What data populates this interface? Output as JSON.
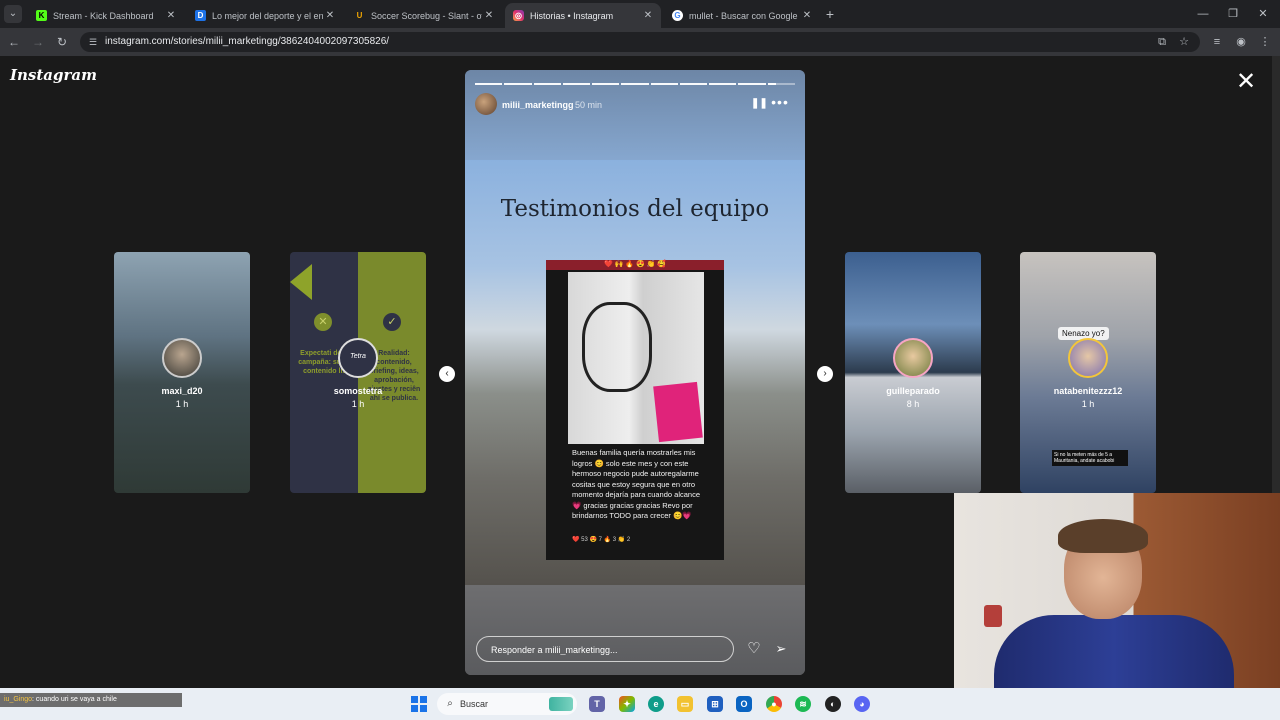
{
  "browser": {
    "tabs": [
      {
        "title": "Stream - Kick Dashboard",
        "favicon": "kick-icon",
        "active": false
      },
      {
        "title": "Lo mejor del deporte y el entre",
        "favicon": "olga-icon",
        "active": false
      },
      {
        "title": "Soccer Scorebug - Slant - over",
        "favicon": "uno-icon",
        "active": false
      },
      {
        "title": "Historias • Instagram",
        "favicon": "instagram-icon",
        "active": true
      },
      {
        "title": "mullet - Buscar con Google",
        "favicon": "google-icon",
        "active": false
      }
    ],
    "url": "instagram.com/stories/milii_marketingg/3862404002097305826/"
  },
  "instagram": {
    "logo": "Instagram",
    "story": {
      "username": "milii_marketingg",
      "time": "50 min",
      "progress_segments": 11,
      "current_segment": 11,
      "current_segment_progress": 0.3,
      "title": "Testimonios del equipo",
      "post_emojis": "❤️ 🙌 🔥 😍 👏 🥰",
      "post_text": "Buenas familia quería mostrarles mis logros 😊 solo este mes y con este hermoso negocio pude autoregalarme cositas que estoy segura que en otro momento dejaría para cuando alcance 💗 gracias gracias gracias Revo por brindarnos TODO para crecer 😊💗",
      "post_reactions": "❤️ 53   😍 7   🔥 3   👏 2",
      "reply_placeholder": "Responder a milii_marketingg..."
    },
    "previews": [
      {
        "username": "maxi_d20",
        "time": "1 h"
      },
      {
        "username": "somostetra",
        "time": "1 h",
        "side_left": "Expectati de una campaña: subir al contenido listo",
        "side_right": "Realidad: contenido, briefing, ideas, aprobación, ajustes y reciên ahí se publica.",
        "avatar_text": "Tetra"
      },
      {
        "username": "guilleparado",
        "time": "8 h"
      },
      {
        "username": "natabenitezzz12",
        "time": "1 h",
        "caption": "Nenazo yo?",
        "subtitle": "Si no la meten más de 5 a Mauritania, andate acabobi"
      }
    ]
  },
  "taskbar": {
    "ticker_user": "iu_Gingo",
    "ticker_text": ": cuando uri se vaya a chile",
    "search_label": "Buscar"
  },
  "colors": {
    "page_bg": "#1a1a1a",
    "browser_dark": "#202124",
    "browser_tab_active": "#35363a",
    "story_bg": "#6b6c6f",
    "preview_lime": "#7a8a2c",
    "taskbar_bg": "#e9eef4",
    "reels_pink": "#e0237a"
  }
}
